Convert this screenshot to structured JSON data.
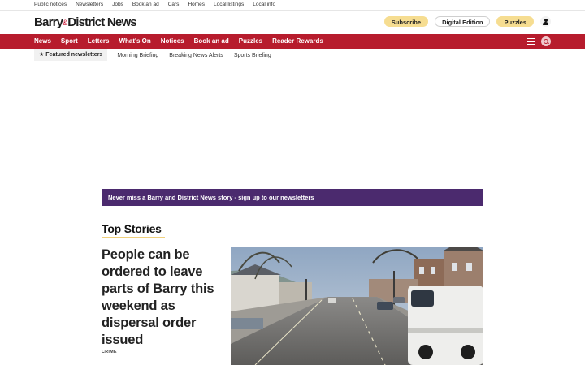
{
  "utility_links": [
    "Public notices",
    "Newsletters",
    "Jobs",
    "Book an ad",
    "Cars",
    "Homes",
    "Local listings",
    "Local info"
  ],
  "masthead": {
    "logo_part1": "Barry",
    "logo_amp": "&",
    "logo_part2": "District News",
    "subscribe_label": "Subscribe",
    "digital_label": "Digital Edition",
    "puzzles_label": "Puzzles"
  },
  "nav": {
    "items": [
      "News",
      "Sport",
      "Letters",
      "What's On",
      "Notices",
      "Book an ad",
      "Puzzles",
      "Reader Rewards"
    ]
  },
  "newsletters": {
    "featured_label": "Featured newsletters",
    "links": [
      "Morning Briefing",
      "Breaking News Alerts",
      "Sports Briefing"
    ]
  },
  "promo": {
    "text": "Never miss a Barry and District News story - sign up to our newsletters"
  },
  "top_stories": {
    "title": "Top Stories",
    "lead": {
      "headline": "People can be ordered to leave parts of Barry this weekend as dispersal order issued",
      "category": "CRIME"
    }
  },
  "colors": {
    "nav_red": "#b71c2d",
    "promo_purple": "#4b2a6e",
    "pill_yellow": "#f6dd91"
  },
  "icons": {
    "account": "account-icon",
    "menu": "menu-icon",
    "search": "search-icon",
    "star": "star-icon"
  }
}
